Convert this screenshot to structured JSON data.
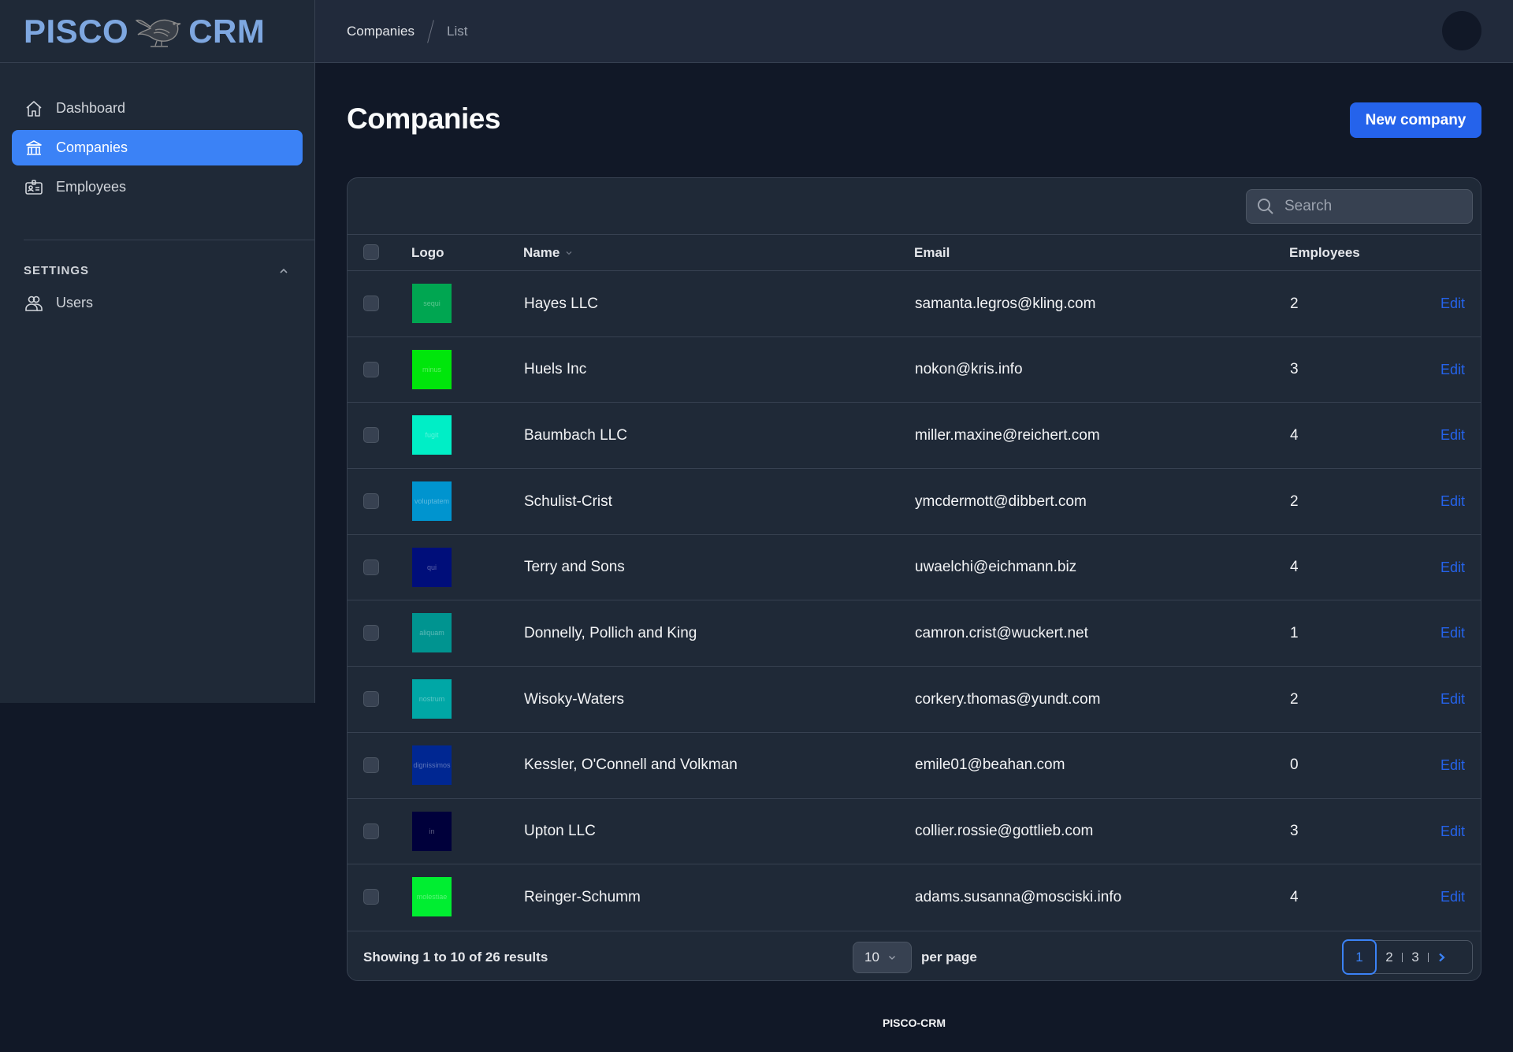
{
  "brand": {
    "left": "PISCO",
    "right": "CRM",
    "icon": "bird-icon"
  },
  "sidebar": {
    "items": [
      {
        "label": "Dashboard",
        "icon": "home-icon",
        "active": false
      },
      {
        "label": "Companies",
        "icon": "building-icon",
        "active": true
      },
      {
        "label": "Employees",
        "icon": "id-card-icon",
        "active": false
      }
    ],
    "settings": {
      "title": "SETTINGS",
      "expanded": true,
      "items": [
        {
          "label": "Users",
          "icon": "users-icon"
        }
      ]
    }
  },
  "header": {
    "breadcrumb": [
      "Companies",
      "List"
    ]
  },
  "page": {
    "title": "Companies",
    "new_button": "New company"
  },
  "table": {
    "search": {
      "placeholder": "Search",
      "value": ""
    },
    "columns": [
      "Logo",
      "Name",
      "Email",
      "Employees"
    ],
    "sorted_column": "Name",
    "action_label": "Edit",
    "rows": [
      {
        "logo_text": "sequi",
        "logo_color": "#00a651",
        "name": "Hayes LLC",
        "email": "samanta.legros@kling.com",
        "employees": "2"
      },
      {
        "logo_text": "minus",
        "logo_color": "#00e60b",
        "name": "Huels Inc",
        "email": "nokon@kris.info",
        "employees": "3"
      },
      {
        "logo_text": "fugit",
        "logo_color": "#00eec6",
        "name": "Baumbach LLC",
        "email": "miller.maxine@reichert.com",
        "employees": "4"
      },
      {
        "logo_text": "voluptatem",
        "logo_color": "#0094cf",
        "name": "Schulist-Crist",
        "email": "ymcdermott@dibbert.com",
        "employees": "2"
      },
      {
        "logo_text": "qui",
        "logo_color": "#000e7a",
        "name": "Terry and Sons",
        "email": "uwaelchi@eichmann.biz",
        "employees": "4"
      },
      {
        "logo_text": "aliquam",
        "logo_color": "#009490",
        "name": "Donnelly, Pollich and King",
        "email": "camron.crist@wuckert.net",
        "employees": "1"
      },
      {
        "logo_text": "nostrum",
        "logo_color": "#00a7a6",
        "name": "Wisoky-Waters",
        "email": "corkery.thomas@yundt.com",
        "employees": "2"
      },
      {
        "logo_text": "dignissimos",
        "logo_color": "#002792",
        "name": "Kessler, O'Connell and Volkman",
        "email": "emile01@beahan.com",
        "employees": "0"
      },
      {
        "logo_text": "in",
        "logo_color": "#00003b",
        "name": "Upton LLC",
        "email": "collier.rossie@gottlieb.com",
        "employees": "3"
      },
      {
        "logo_text": "molestiae",
        "logo_color": "#00ee31",
        "name": "Reinger-Schumm",
        "email": "adams.susanna@mosciski.info",
        "employees": "4"
      }
    ],
    "footer": {
      "showing": "Showing 1 to 10 of 26 results",
      "per_page_value": "10",
      "per_page_label": "per page",
      "pages": [
        "1",
        "2",
        "3"
      ],
      "current_page": "1"
    }
  },
  "footer": {
    "text": "PISCO-CRM"
  }
}
